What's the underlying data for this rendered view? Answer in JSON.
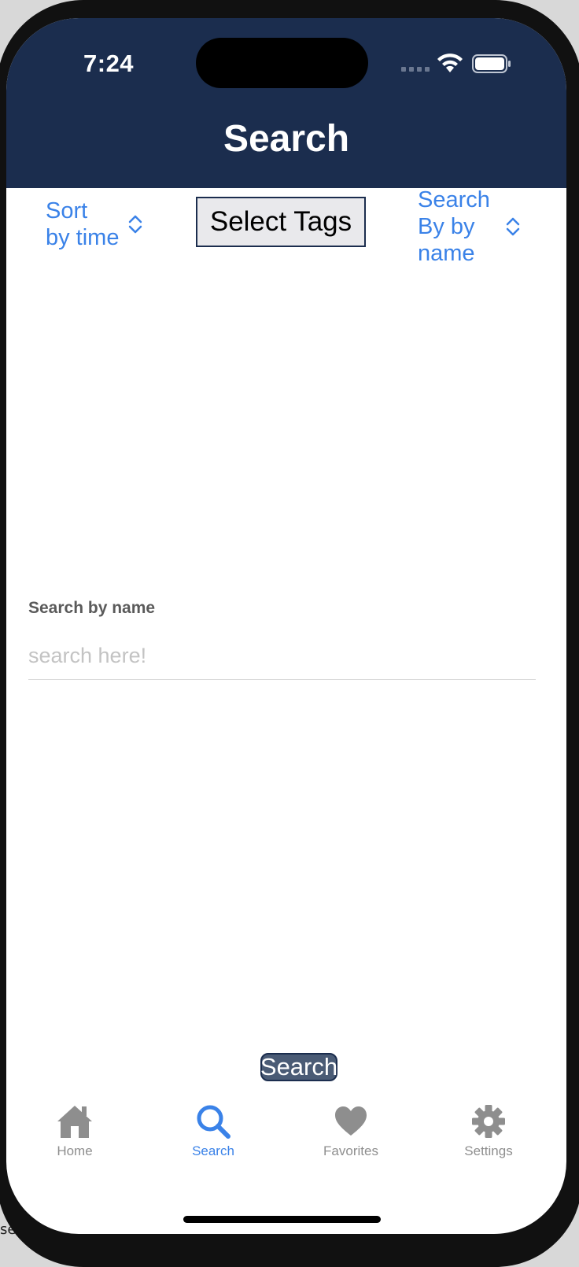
{
  "corner_text": "se",
  "status_bar": {
    "time": "7:24"
  },
  "header": {
    "title": "Search"
  },
  "controls": {
    "sort_picker": {
      "label": "Sort\nby time"
    },
    "select_tags_button": "Select Tags",
    "search_by_picker": {
      "label": "Search\nBy by\nname"
    }
  },
  "search": {
    "field_label": "Search by name",
    "placeholder": "search here!",
    "value": "",
    "button_label": "Search"
  },
  "tabs": [
    {
      "label": "Home",
      "icon": "house-icon",
      "active": false
    },
    {
      "label": "Search",
      "icon": "magnifier-icon",
      "active": true
    },
    {
      "label": "Favorites",
      "icon": "heart-icon",
      "active": false
    },
    {
      "label": "Settings",
      "icon": "gear-icon",
      "active": false
    }
  ],
  "colors": {
    "header_bg": "#1b2d4e",
    "accent": "#3a82e8",
    "inactive_tab": "#8e8e8e",
    "button_bg": "#4a5b75"
  }
}
